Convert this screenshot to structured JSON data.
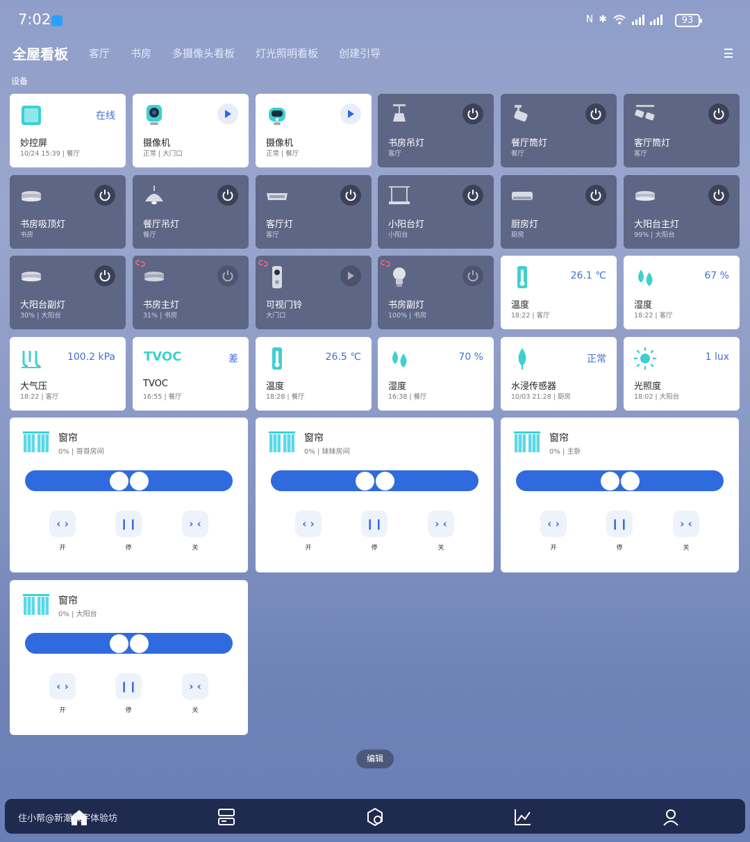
{
  "status_bar": {
    "time": "7:02",
    "battery": "93"
  },
  "tabs": {
    "active": "全屋看板",
    "items": [
      "客厅",
      "书房",
      "多摄像头看板",
      "灯光照明看板",
      "创建引导"
    ]
  },
  "section_label": "设备",
  "devices": [
    {
      "name": "妙控屏",
      "sub": "10/24 15:39 | 餐厅",
      "value": "在线"
    },
    {
      "name": "摄像机",
      "sub": "正常 | 大门口"
    },
    {
      "name": "摄像机",
      "sub": "正常 | 餐厅"
    },
    {
      "name": "书房吊灯",
      "sub": "客厅"
    },
    {
      "name": "餐厅筒灯",
      "sub": "餐厅"
    },
    {
      "name": "客厅筒灯",
      "sub": "客厅"
    },
    {
      "name": "书房吸顶灯",
      "sub": "书房"
    },
    {
      "name": "餐厅吊灯",
      "sub": "餐厅"
    },
    {
      "name": "客厅灯",
      "sub": "客厅"
    },
    {
      "name": "小阳台灯",
      "sub": "小阳台"
    },
    {
      "name": "厨房灯",
      "sub": "厨房"
    },
    {
      "name": "大阳台主灯",
      "sub": "99% | 大阳台"
    },
    {
      "name": "大阳台副灯",
      "sub": "30% | 大阳台"
    },
    {
      "name": "书房主灯",
      "sub": "31% | 书房"
    },
    {
      "name": "可视门铃",
      "sub": "大门口"
    },
    {
      "name": "书房副灯",
      "sub": "100% | 书房"
    },
    {
      "name": "温度",
      "sub": "18:22 | 客厅",
      "value": "26.1 ℃"
    },
    {
      "name": "湿度",
      "sub": "18:22 | 客厅",
      "value": "67 %"
    },
    {
      "name": "大气压",
      "sub": "18:22 | 客厅",
      "value": "100.2 kPa"
    },
    {
      "name": "TVOC",
      "sub": "16:55 | 餐厅",
      "value": "差",
      "icon_text": "TVOC"
    },
    {
      "name": "温度",
      "sub": "18:28 | 餐厅",
      "value": "26.5 ℃"
    },
    {
      "name": "湿度",
      "sub": "16:38 | 餐厅",
      "value": "70 %"
    },
    {
      "name": "水浸传感器",
      "sub": "10/03 21:28 | 厨房",
      "value": "正常"
    },
    {
      "name": "光照度",
      "sub": "18:02 | 大阳台",
      "value": "1 lux"
    }
  ],
  "curtains": [
    {
      "name": "窗帘",
      "sub": "0% | 哥哥房间",
      "position_percent": 0
    },
    {
      "name": "窗帘",
      "sub": "0% | 妹妹房间",
      "position_percent": 0
    },
    {
      "name": "窗帘",
      "sub": "0% | 主卧",
      "position_percent": 0
    },
    {
      "name": "窗帘",
      "sub": "0% | 大阳台",
      "position_percent": 0
    }
  ],
  "curtain_buttons": {
    "open": "开",
    "pause": "停",
    "close": "关"
  },
  "edit_button": "编辑",
  "watermark": "住小帮@新潮数字体验坊",
  "colors": {
    "accent": "#2f6bde",
    "dark_card": "#5d6685",
    "value_blue": "#3f6fd8",
    "sensor_icon": "#3ed0d0"
  }
}
